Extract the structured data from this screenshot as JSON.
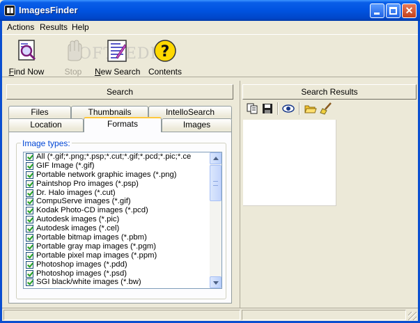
{
  "window": {
    "title": "ImagesFinder"
  },
  "menu": {
    "items": [
      "Actions",
      "Results",
      "Help"
    ]
  },
  "toolbar": {
    "find_now": "Find Now",
    "stop": "Stop",
    "new_search": "New Search",
    "contents": "Contents",
    "watermark": "SOFTPEDIA"
  },
  "left_pane": {
    "search_button": "Search",
    "tabs_row1": [
      "Files",
      "Thumbnails",
      "IntelloSearch"
    ],
    "tabs_row2": [
      "Location",
      "Formats",
      "Images"
    ],
    "active_tab": "Formats",
    "group_title": "Image types:",
    "image_types": [
      "All (*.gif;*.png;*.psp;*.cut;*.gif;*.pcd;*.pic;*.ce",
      "GIF Image (*.gif)",
      "Portable network graphic images (*.png)",
      "Paintshop Pro images (*.psp)",
      "Dr. Halo images (*.cut)",
      "CompuServe images (*.gif)",
      "Kodak Photo-CD images (*.pcd)",
      "Autodesk images (*.pic)",
      "Autodesk images (*.cel)",
      "Portable bitmap images (*.pbm)",
      "Portable gray map images (*.pgm)",
      "Portable pixel map images (*.ppm)",
      "Photoshop images (*.pdd)",
      "Photoshop images (*.psd)",
      "SGI black/white images (*.bw)"
    ]
  },
  "right_pane": {
    "results_button": "Search Results",
    "tools": [
      "copy-icon",
      "save-icon",
      "view-icon",
      "open-folder-icon",
      "clear-icon"
    ]
  },
  "colors": {
    "title_bar": "#0053e0",
    "legend": "#0046d5",
    "active_tab_accent": "#ffc83c",
    "check": "#21a121"
  }
}
